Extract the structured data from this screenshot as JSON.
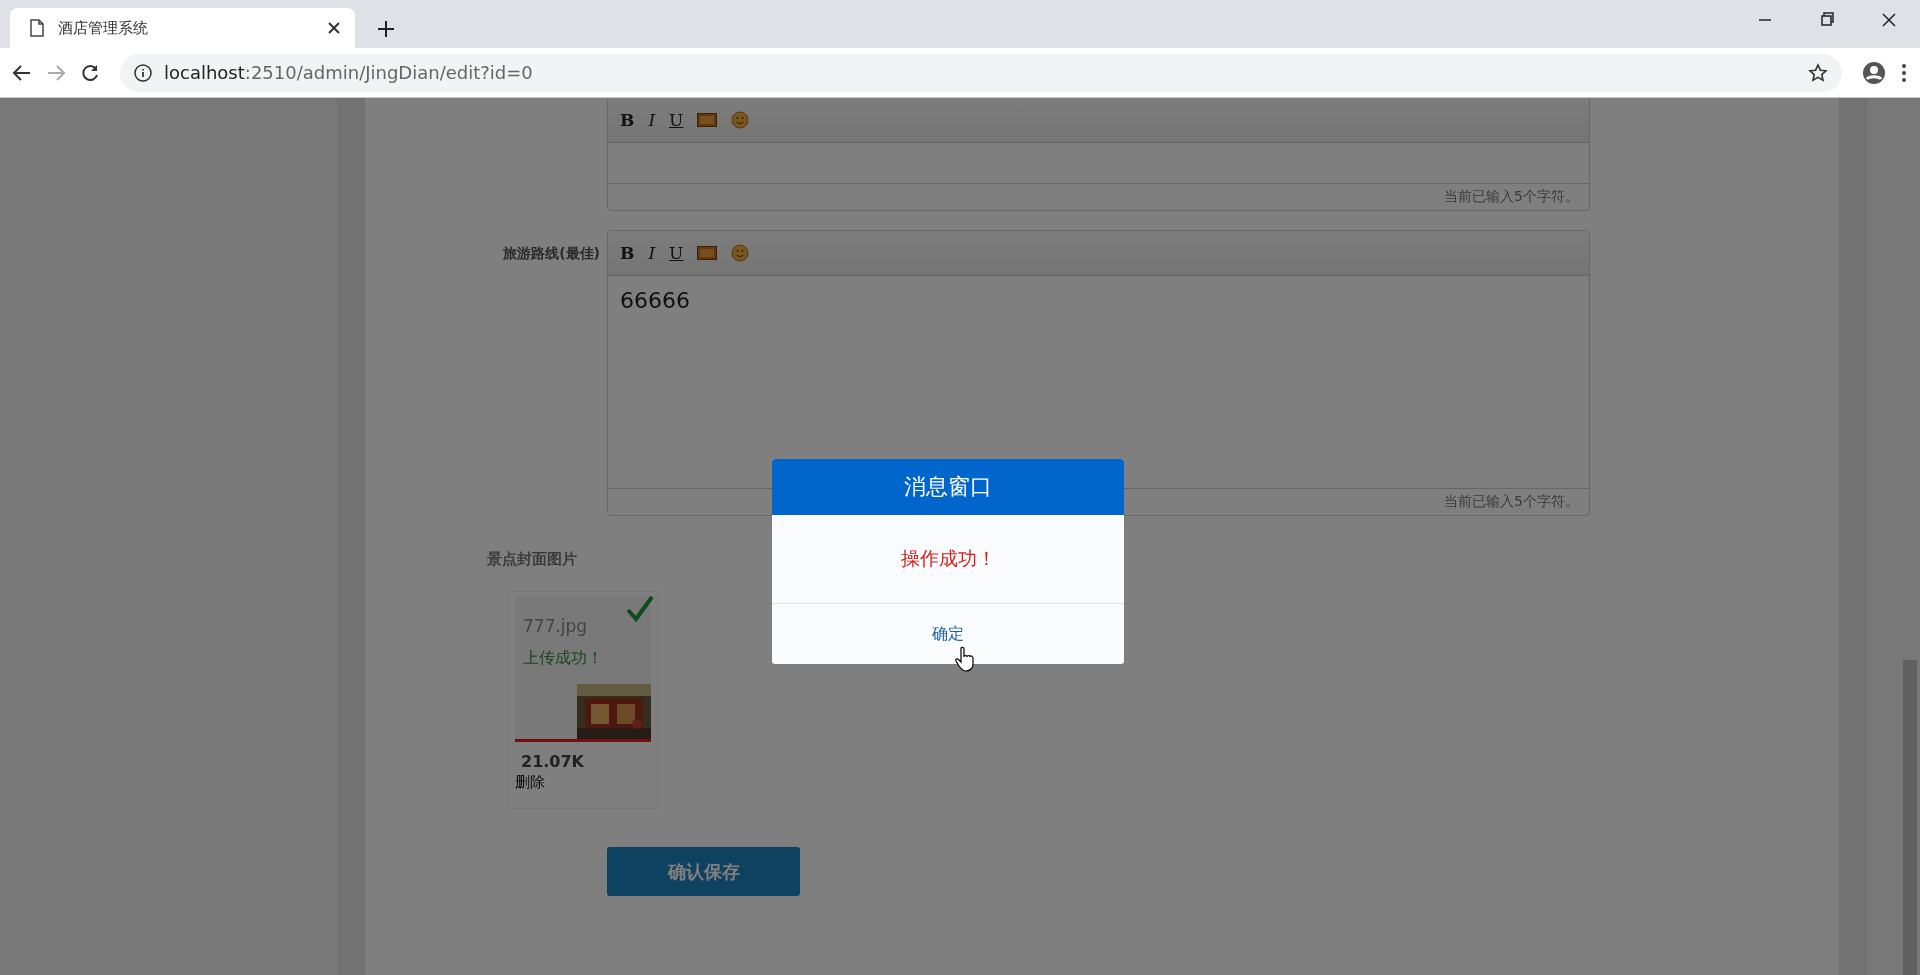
{
  "browser": {
    "tab_title": "酒店管理系统",
    "url_host": "localhost",
    "url_path": ":2510/admin/JingDian/edit?id=0"
  },
  "editors": [
    {
      "toolbar": [
        "B",
        "I",
        "U"
      ],
      "counter": "当前已输入5个字符。"
    },
    {
      "label": "旅游路线(最佳)",
      "toolbar": [
        "B",
        "I",
        "U"
      ],
      "value": "66666",
      "counter": "当前已输入5个字符。"
    }
  ],
  "cover": {
    "label": "景点封面图片",
    "file": {
      "name": "777.jpg",
      "status": "上传成功！",
      "size": "21.07K",
      "delete": "删除",
      "level": 1
    }
  },
  "save_button": "确认保存",
  "modal": {
    "title": "消息窗口",
    "message": "操作成功！",
    "button": "确定"
  }
}
